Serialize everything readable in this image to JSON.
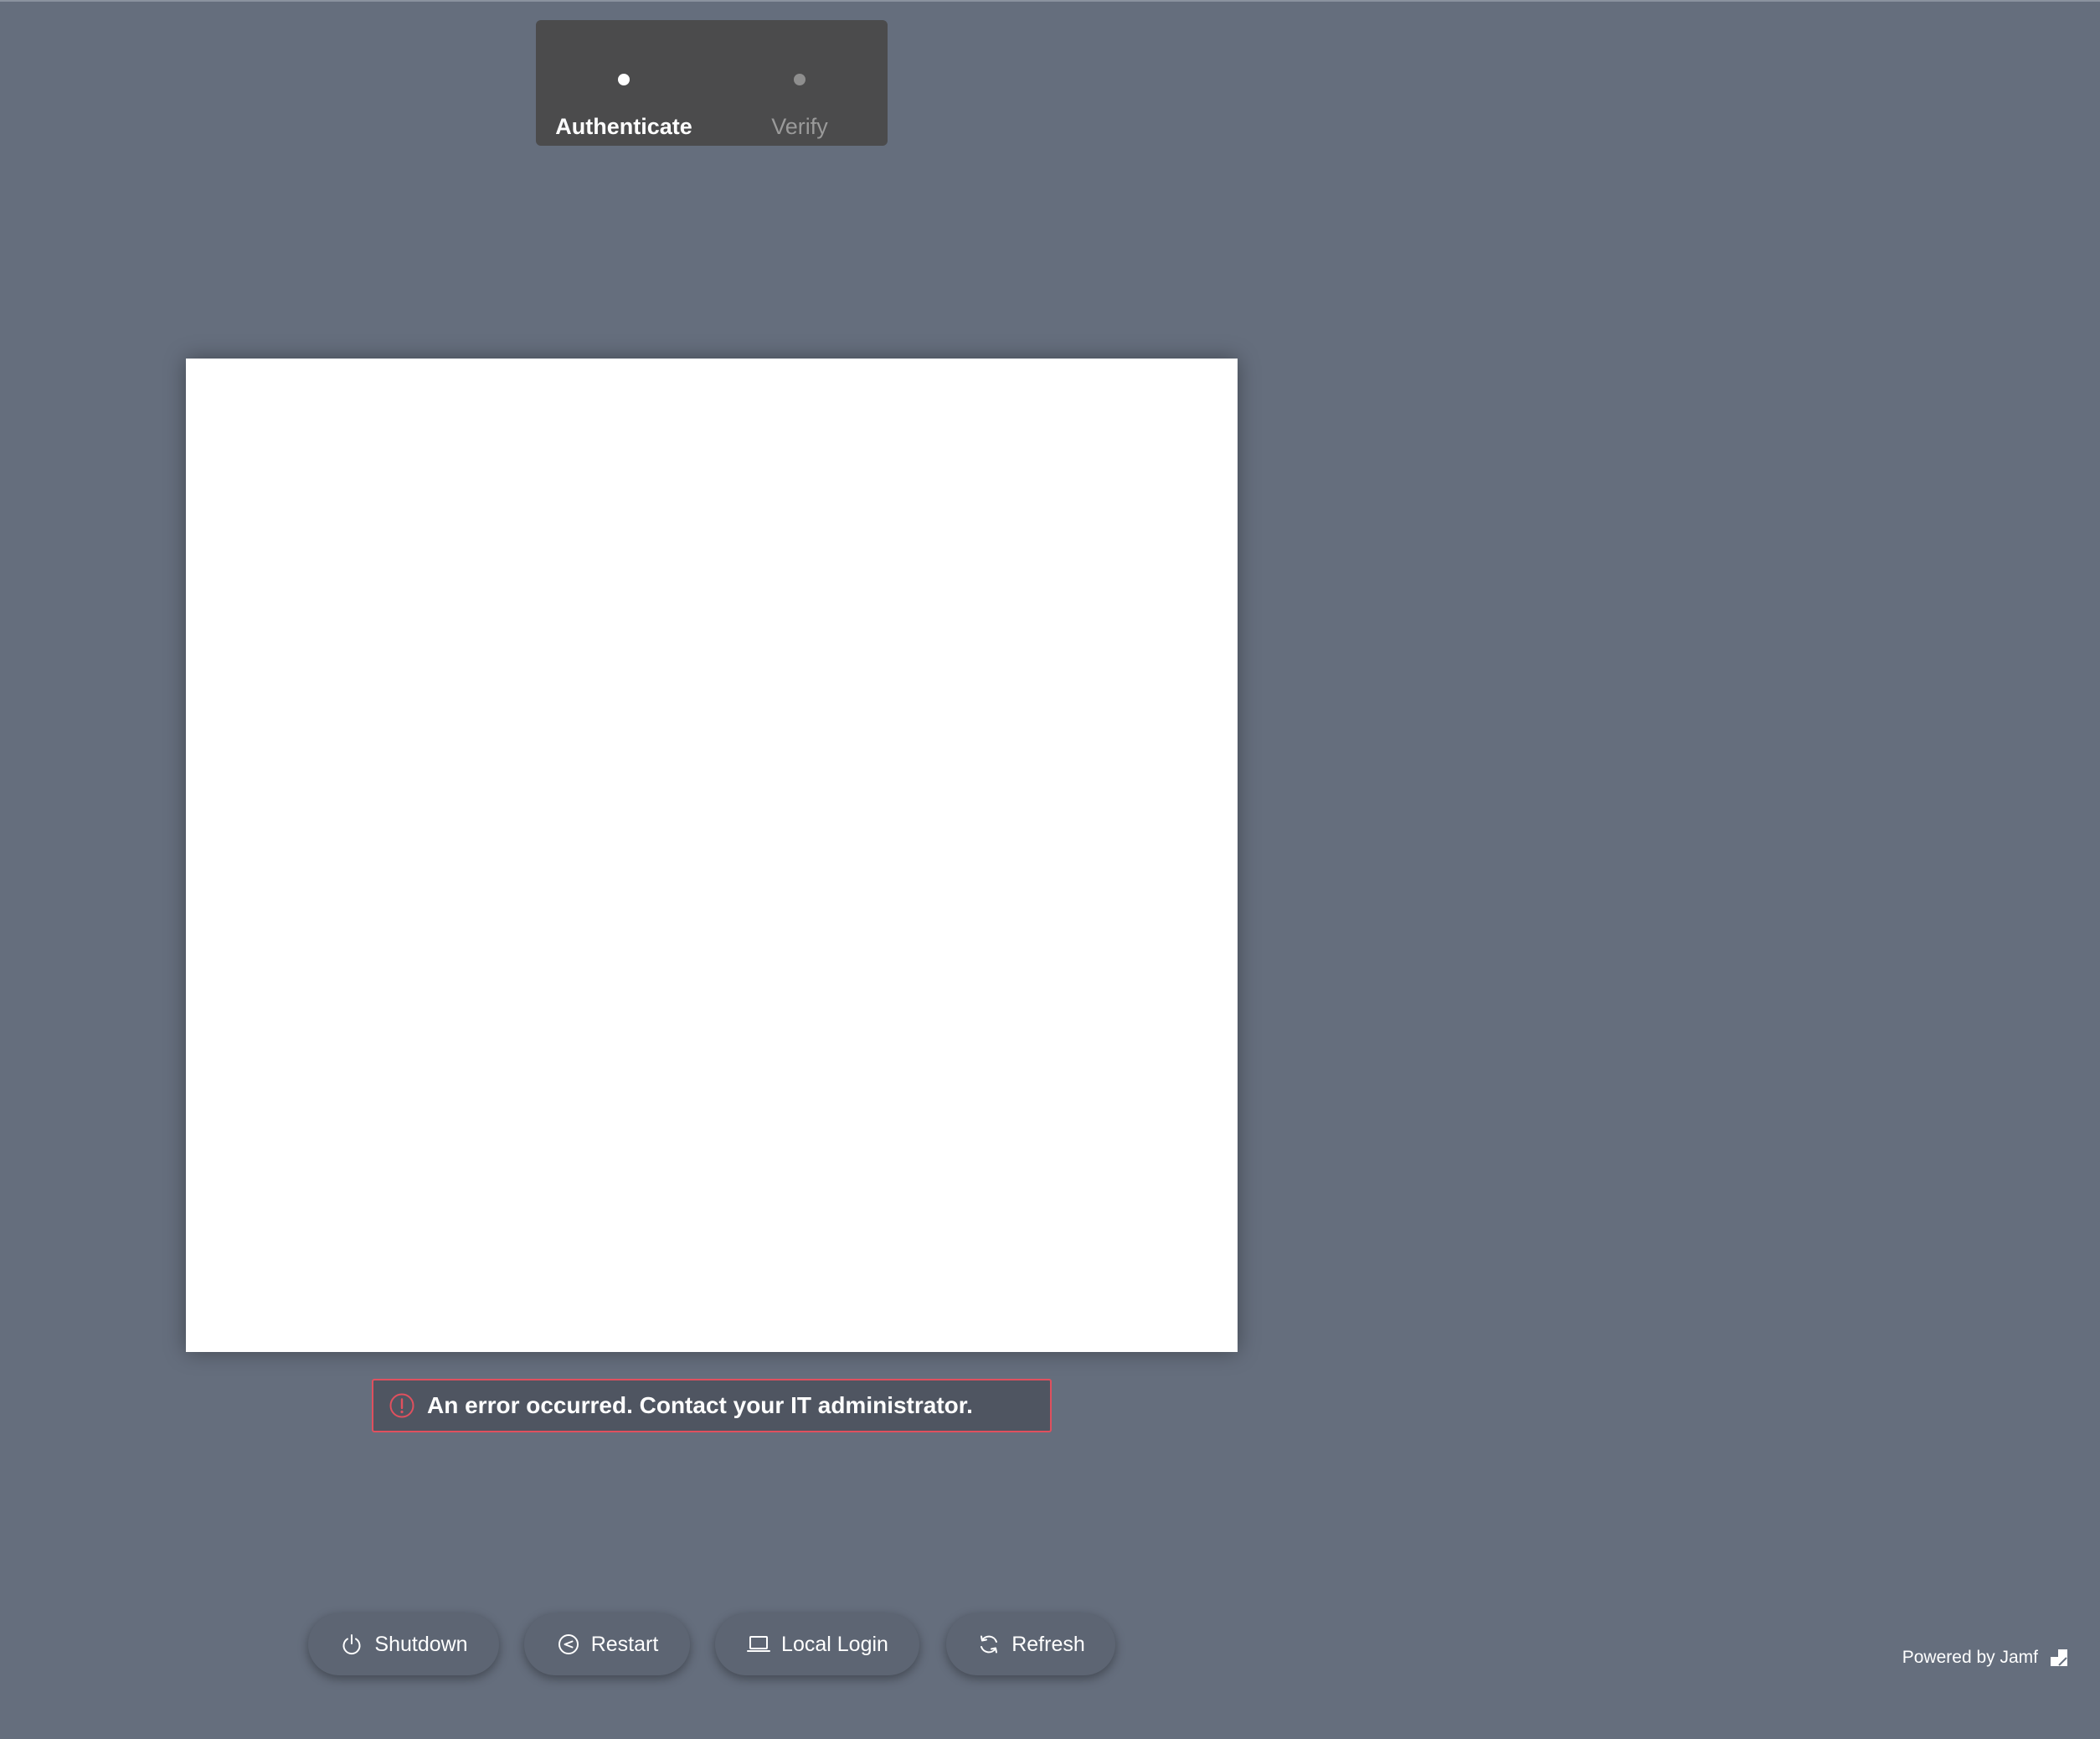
{
  "stepper": {
    "steps": [
      {
        "label": "Authenticate",
        "state": "active"
      },
      {
        "label": "Verify",
        "state": "inactive"
      }
    ]
  },
  "error": {
    "icon": "alert-circle-icon",
    "message": "An error occurred. Contact your IT administrator.",
    "color": "#e0505e"
  },
  "actions": {
    "shutdown": {
      "label": "Shutdown",
      "icon": "power-icon"
    },
    "restart": {
      "label": "Restart",
      "icon": "restart-icon"
    },
    "local_login": {
      "label": "Local Login",
      "icon": "laptop-icon"
    },
    "refresh": {
      "label": "Refresh",
      "icon": "refresh-icon"
    }
  },
  "footer": {
    "powered_by": "Powered by Jamf",
    "logo_icon": "jamf-logo-icon"
  },
  "colors": {
    "background": "#656e7d",
    "stepper_background": "#4b4b4c",
    "panel": "#ffffff"
  }
}
